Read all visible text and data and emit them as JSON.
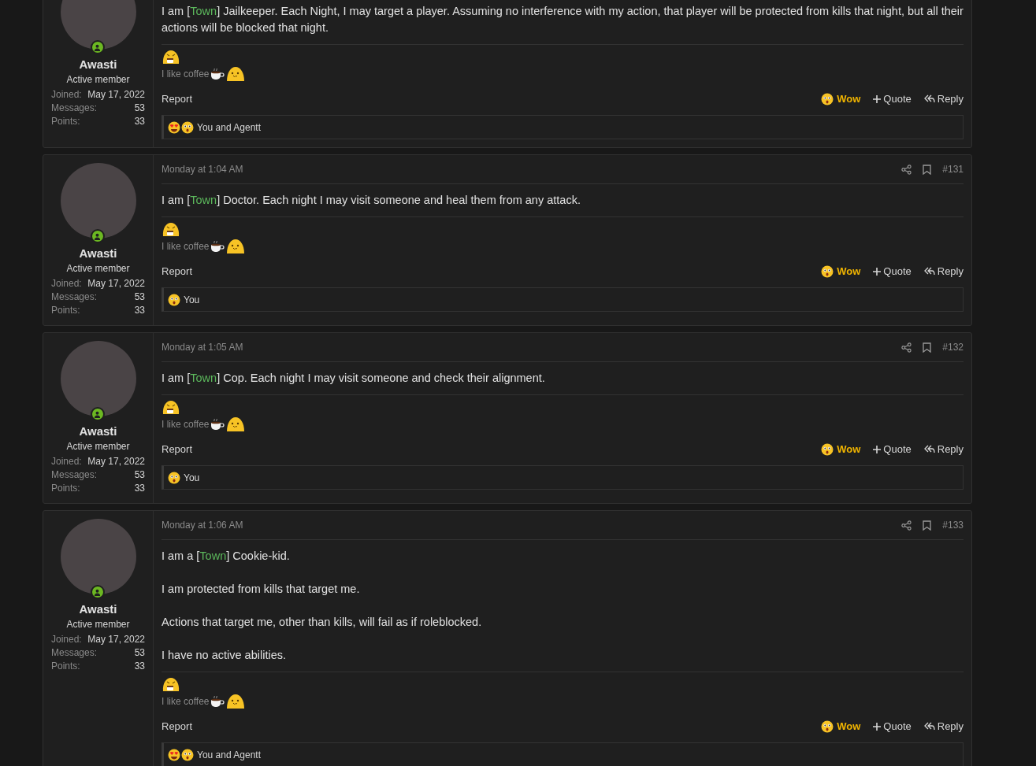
{
  "posts": [
    {
      "user": {
        "name": "Awasti",
        "title": "Active member",
        "online": true,
        "stats": [
          {
            "label": "Joined:",
            "value": "May 17, 2022"
          },
          {
            "label": "Messages:",
            "value": "53"
          },
          {
            "label": "Points:",
            "value": "33"
          }
        ]
      },
      "body": [
        [
          {
            "kind": "plain",
            "text": "I am ["
          },
          {
            "kind": "tag",
            "text": "Town"
          },
          {
            "kind": "plain",
            "text": "] Jailkeeper. Each Night, I may target a player. Assuming no interference with my action, that player will be protected from kills that night, but all their actions will be blocked that night."
          }
        ]
      ],
      "signature": "I like coffee",
      "actions": {
        "report": "Report",
        "reaction": "Wow",
        "quote": "Quote",
        "reply": "Reply"
      },
      "reactions": {
        "emojis": [
          {
            "kind": "love"
          },
          {
            "kind": "wow"
          }
        ],
        "text": "You and Agentt"
      }
    },
    {
      "header": {
        "date": "Monday at 1:04 AM",
        "number": "#131"
      },
      "user": {
        "name": "Awasti",
        "title": "Active member",
        "online": true,
        "stats": [
          {
            "label": "Joined:",
            "value": "May 17, 2022"
          },
          {
            "label": "Messages:",
            "value": "53"
          },
          {
            "label": "Points:",
            "value": "33"
          }
        ]
      },
      "body": [
        [
          {
            "kind": "plain",
            "text": "I am ["
          },
          {
            "kind": "tag",
            "text": "Town"
          },
          {
            "kind": "plain",
            "text": "] Doctor. Each night I may visit someone and heal them from any attack."
          }
        ]
      ],
      "signature": "I like coffee",
      "actions": {
        "report": "Report",
        "reaction": "Wow",
        "quote": "Quote",
        "reply": "Reply"
      },
      "reactions": {
        "emojis": [
          {
            "kind": "wow"
          }
        ],
        "text": "You"
      }
    },
    {
      "header": {
        "date": "Monday at 1:05 AM",
        "number": "#132"
      },
      "user": {
        "name": "Awasti",
        "title": "Active member",
        "online": true,
        "stats": [
          {
            "label": "Joined:",
            "value": "May 17, 2022"
          },
          {
            "label": "Messages:",
            "value": "53"
          },
          {
            "label": "Points:",
            "value": "33"
          }
        ]
      },
      "body": [
        [
          {
            "kind": "plain",
            "text": "I am ["
          },
          {
            "kind": "tag",
            "text": "Town"
          },
          {
            "kind": "plain",
            "text": "] Cop. Each night I may visit someone and check their alignment."
          }
        ]
      ],
      "signature": "I like coffee",
      "actions": {
        "report": "Report",
        "reaction": "Wow",
        "quote": "Quote",
        "reply": "Reply"
      },
      "reactions": {
        "emojis": [
          {
            "kind": "wow"
          }
        ],
        "text": "You"
      }
    },
    {
      "header": {
        "date": "Monday at 1:06 AM",
        "number": "#133"
      },
      "user": {
        "name": "Awasti",
        "title": "Active member",
        "online": true,
        "stats": [
          {
            "label": "Joined:",
            "value": "May 17, 2022"
          },
          {
            "label": "Messages:",
            "value": "53"
          },
          {
            "label": "Points:",
            "value": "33"
          }
        ]
      },
      "body": [
        [
          {
            "kind": "plain",
            "text": "I am a ["
          },
          {
            "kind": "tag",
            "text": "Town"
          },
          {
            "kind": "plain",
            "text": "] Cookie-kid."
          }
        ],
        [
          {
            "kind": "plain",
            "text": "I am protected from kills that target me."
          }
        ],
        [
          {
            "kind": "plain",
            "text": "Actions that target me, other than kills, will fail as if roleblocked."
          }
        ],
        [
          {
            "kind": "plain",
            "text": "I have no active abilities."
          }
        ]
      ],
      "signature": "I like coffee",
      "actions": {
        "report": "Report",
        "reaction": "Wow",
        "quote": "Quote",
        "reply": "Reply"
      },
      "reactions": {
        "emojis": [
          {
            "kind": "love"
          },
          {
            "kind": "wow"
          }
        ],
        "text": "You and Agentt"
      }
    }
  ]
}
